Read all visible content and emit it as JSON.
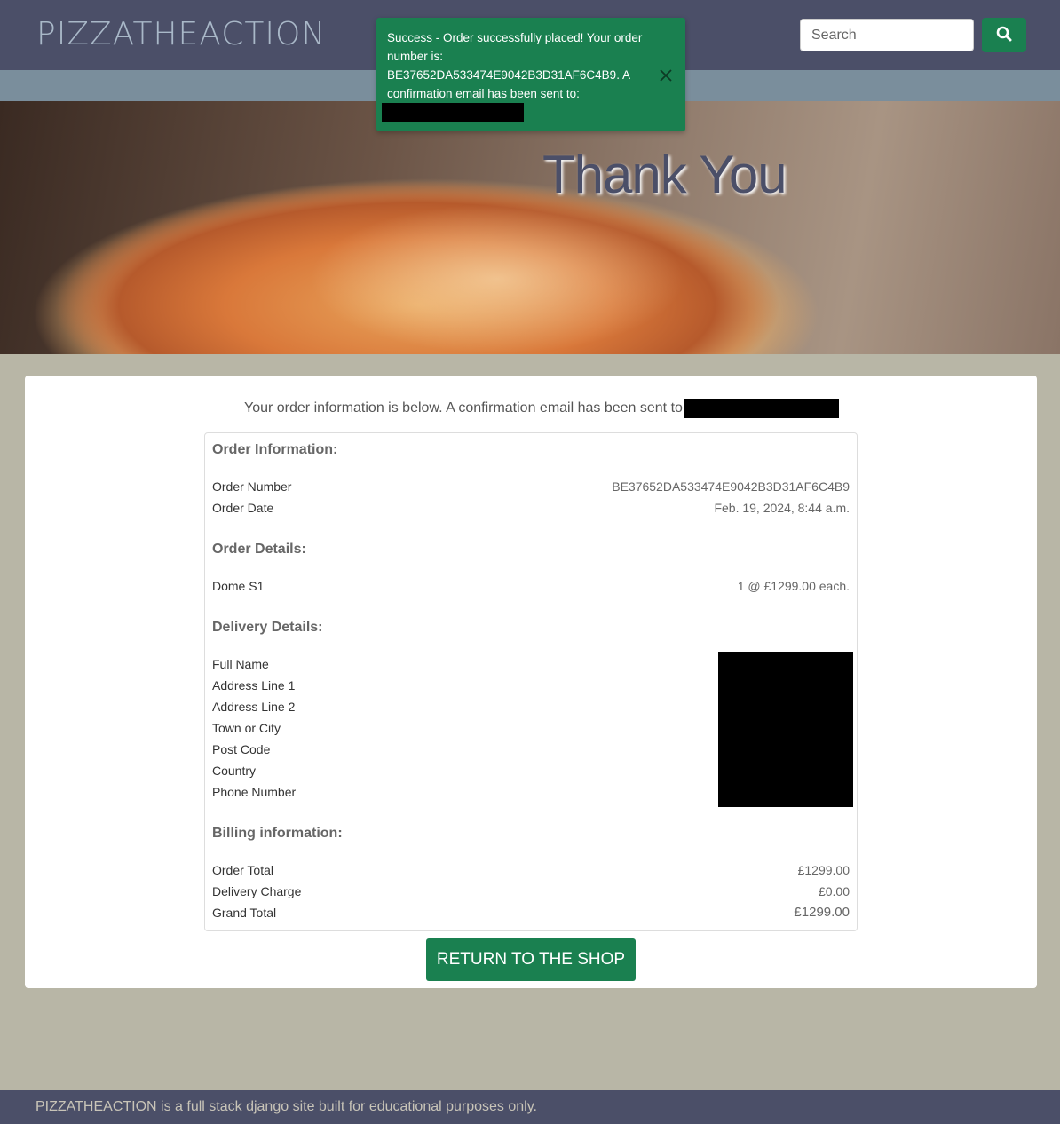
{
  "header": {
    "logo": "PIZZATHEACTION",
    "search_placeholder": "Search"
  },
  "hero": {
    "title": "Thank You"
  },
  "toast": {
    "message": "Success - Order successfully placed! Your order number is: BE37652DA533474E9042B3D31AF6C4B9. A confirmation email has been sent to:"
  },
  "order": {
    "intro": "Your order information is below. A confirmation email has been sent to",
    "sections": {
      "order_information": "Order Information:",
      "order_details": "Order Details:",
      "delivery_details": "Delivery Details:",
      "billing_information": "Billing information:"
    },
    "order_number_label": "Order Number",
    "order_number": "BE37652DA533474E9042B3D31AF6C4B9",
    "order_date_label": "Order Date",
    "order_date": "Feb. 19, 2024, 8:44 a.m.",
    "item_name": "Dome S1",
    "item_qty": "1 @ £1299.00 each.",
    "delivery_labels": [
      "Full Name",
      "Address Line 1",
      "Address Line 2",
      "Town or City",
      "Post Code",
      "Country",
      "Phone Number"
    ],
    "order_total_label": "Order Total",
    "order_total": "£1299.00",
    "delivery_charge_label": "Delivery Charge",
    "delivery_charge": "£0.00",
    "grand_total_label": "Grand Total",
    "grand_total": "£1299.00"
  },
  "return_button": "RETURN TO THE SHOP",
  "footer": "PIZZATHEACTION is a full stack django site built for educational purposes only.",
  "colors": {
    "nav": "#4b4f68",
    "accent_green": "#1a8050",
    "page_bg": "#b8b6a6"
  }
}
